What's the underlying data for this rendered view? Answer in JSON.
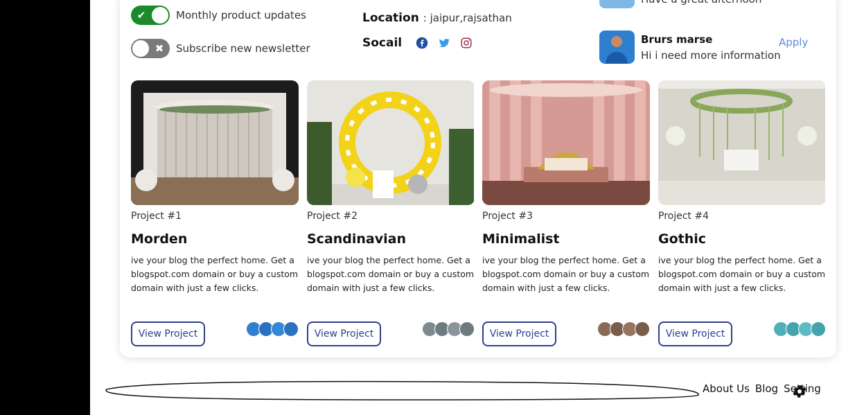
{
  "settings": {
    "toggles": [
      {
        "label": "Monthly product updates",
        "state": "on"
      },
      {
        "label": "Subscribe new newsletter",
        "state": "off"
      }
    ]
  },
  "profile": {
    "location_label": "Location",
    "location_value": ": jaipur,rajsathan",
    "social_label": "Socail",
    "social_icons": [
      "facebook-icon",
      "twitter-icon",
      "instagram-icon"
    ]
  },
  "conversations": {
    "partial_message": "Have a great afternoon",
    "items": [
      {
        "name": "Brurs marse",
        "message": "Hi i need more information",
        "action": "Apply"
      }
    ]
  },
  "projects": [
    {
      "number": "Project #1",
      "title": "Morden",
      "description": "ive your blog the perfect home. Get a blogspot.com domain or buy a custom domain with just a few clicks.",
      "button": "View Project"
    },
    {
      "number": "Project #2",
      "title": "Scandinavian",
      "description": "ive your blog the perfect home. Get a blogspot.com domain or buy a custom domain with just a few clicks.",
      "button": "View Project"
    },
    {
      "number": "Project #3",
      "title": "Minimalist",
      "description": "ive your blog the perfect home. Get a blogspot.com domain or buy a custom domain with just a few clicks.",
      "button": "View Project"
    },
    {
      "number": "Project #4",
      "title": "Gothic",
      "description": "ive your blog the perfect home. Get a blogspot.com domain or buy a custom domain with just a few clicks.",
      "button": "View Project"
    }
  ],
  "footer": {
    "links": [
      "About Us",
      "Blog",
      "Setting"
    ]
  },
  "colors": {
    "toggle_on": "#1a8a2a",
    "toggle_off": "#7a7a7a",
    "button_border": "#2d3f8f",
    "apply_link": "#5b8bd8"
  }
}
